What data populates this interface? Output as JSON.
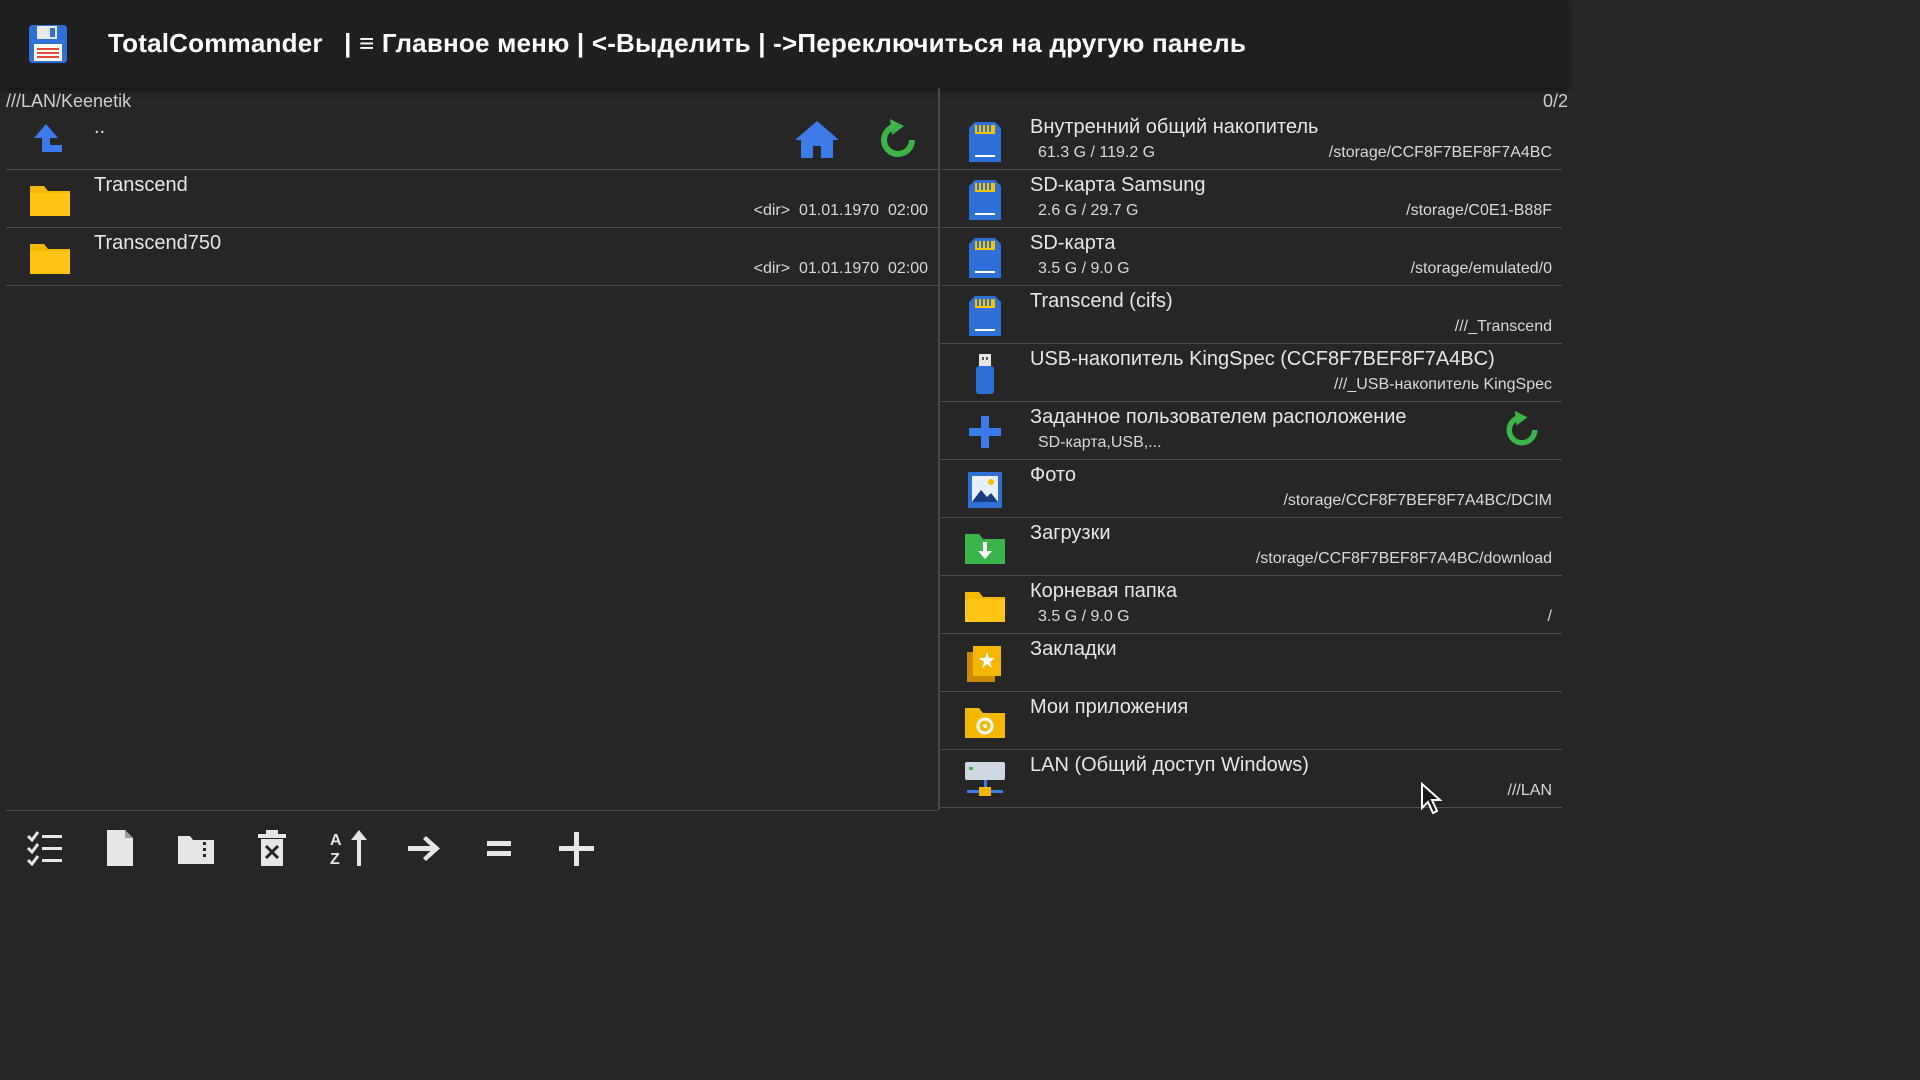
{
  "title_bar": {
    "app_name": "TotalCommander",
    "hint_text": "| ≡ Главное меню | <-Выделить  |  ->Переключиться на другую панель"
  },
  "left_panel": {
    "path": "///LAN/Keenetik",
    "selection_count": "0/2",
    "up_label": "..",
    "files": [
      {
        "name": "Transcend",
        "meta": "<dir>  01.01.1970  02:00",
        "icon": "folder-icon"
      },
      {
        "name": "Transcend750",
        "meta": "<dir>  01.01.1970  02:00",
        "icon": "folder-icon"
      }
    ]
  },
  "right_panel": {
    "locations": [
      {
        "name": "Внутренний общий накопитель",
        "size": "61.3 G / 119.2 G",
        "path": "/storage/CCF8F7BEF8F7A4BC",
        "icon": "sd-card-icon"
      },
      {
        "name": "SD-карта Samsung",
        "size": "2.6 G / 29.7 G",
        "path": "/storage/C0E1-B88F",
        "icon": "sd-card-icon"
      },
      {
        "name": "SD-карта",
        "size": "3.5 G / 9.0 G",
        "path": "/storage/emulated/0",
        "icon": "sd-card-icon"
      },
      {
        "name": "Transcend (cifs)",
        "size": "",
        "path": "///_Transcend",
        "icon": "sd-card-icon"
      },
      {
        "name": "USB-накопитель KingSpec (CCF8F7BEF8F7A4BC)",
        "size": "",
        "path": "///_USB-накопитель KingSpec",
        "icon": "usb-drive-icon"
      },
      {
        "name": "Заданное пользователем расположение",
        "size": "SD-карта,USB,...",
        "path": "",
        "icon": "plus-icon"
      },
      {
        "name": "Фото",
        "size": "",
        "path": "/storage/CCF8F7BEF8F7A4BC/DCIM",
        "icon": "photo-icon"
      },
      {
        "name": "Загрузки",
        "size": "",
        "path": "/storage/CCF8F7BEF8F7A4BC/download",
        "icon": "download-folder-icon"
      },
      {
        "name": "Корневая папка",
        "size": "3.5 G / 9.0 G",
        "path": "/",
        "icon": "folder-icon"
      },
      {
        "name": "Закладки",
        "size": "",
        "path": "",
        "icon": "bookmarks-icon"
      },
      {
        "name": "Мои приложения",
        "size": "",
        "path": "",
        "icon": "apps-folder-icon"
      },
      {
        "name": "LAN (Общий доступ Windows)",
        "size": "",
        "path": "///LAN",
        "icon": "lan-icon"
      }
    ]
  },
  "toolbar": {
    "buttons": [
      "select-list-icon",
      "new-file-icon",
      "archive-icon",
      "delete-icon",
      "sort-icon",
      "arrow-right-icon",
      "equals-icon",
      "plus-icon"
    ]
  },
  "colors": {
    "background": "#262626",
    "title_bar": "#1f1f1f",
    "folder": "#f5b800",
    "accent_blue": "#3d7ce8",
    "refresh_green": "#3bb54a"
  }
}
